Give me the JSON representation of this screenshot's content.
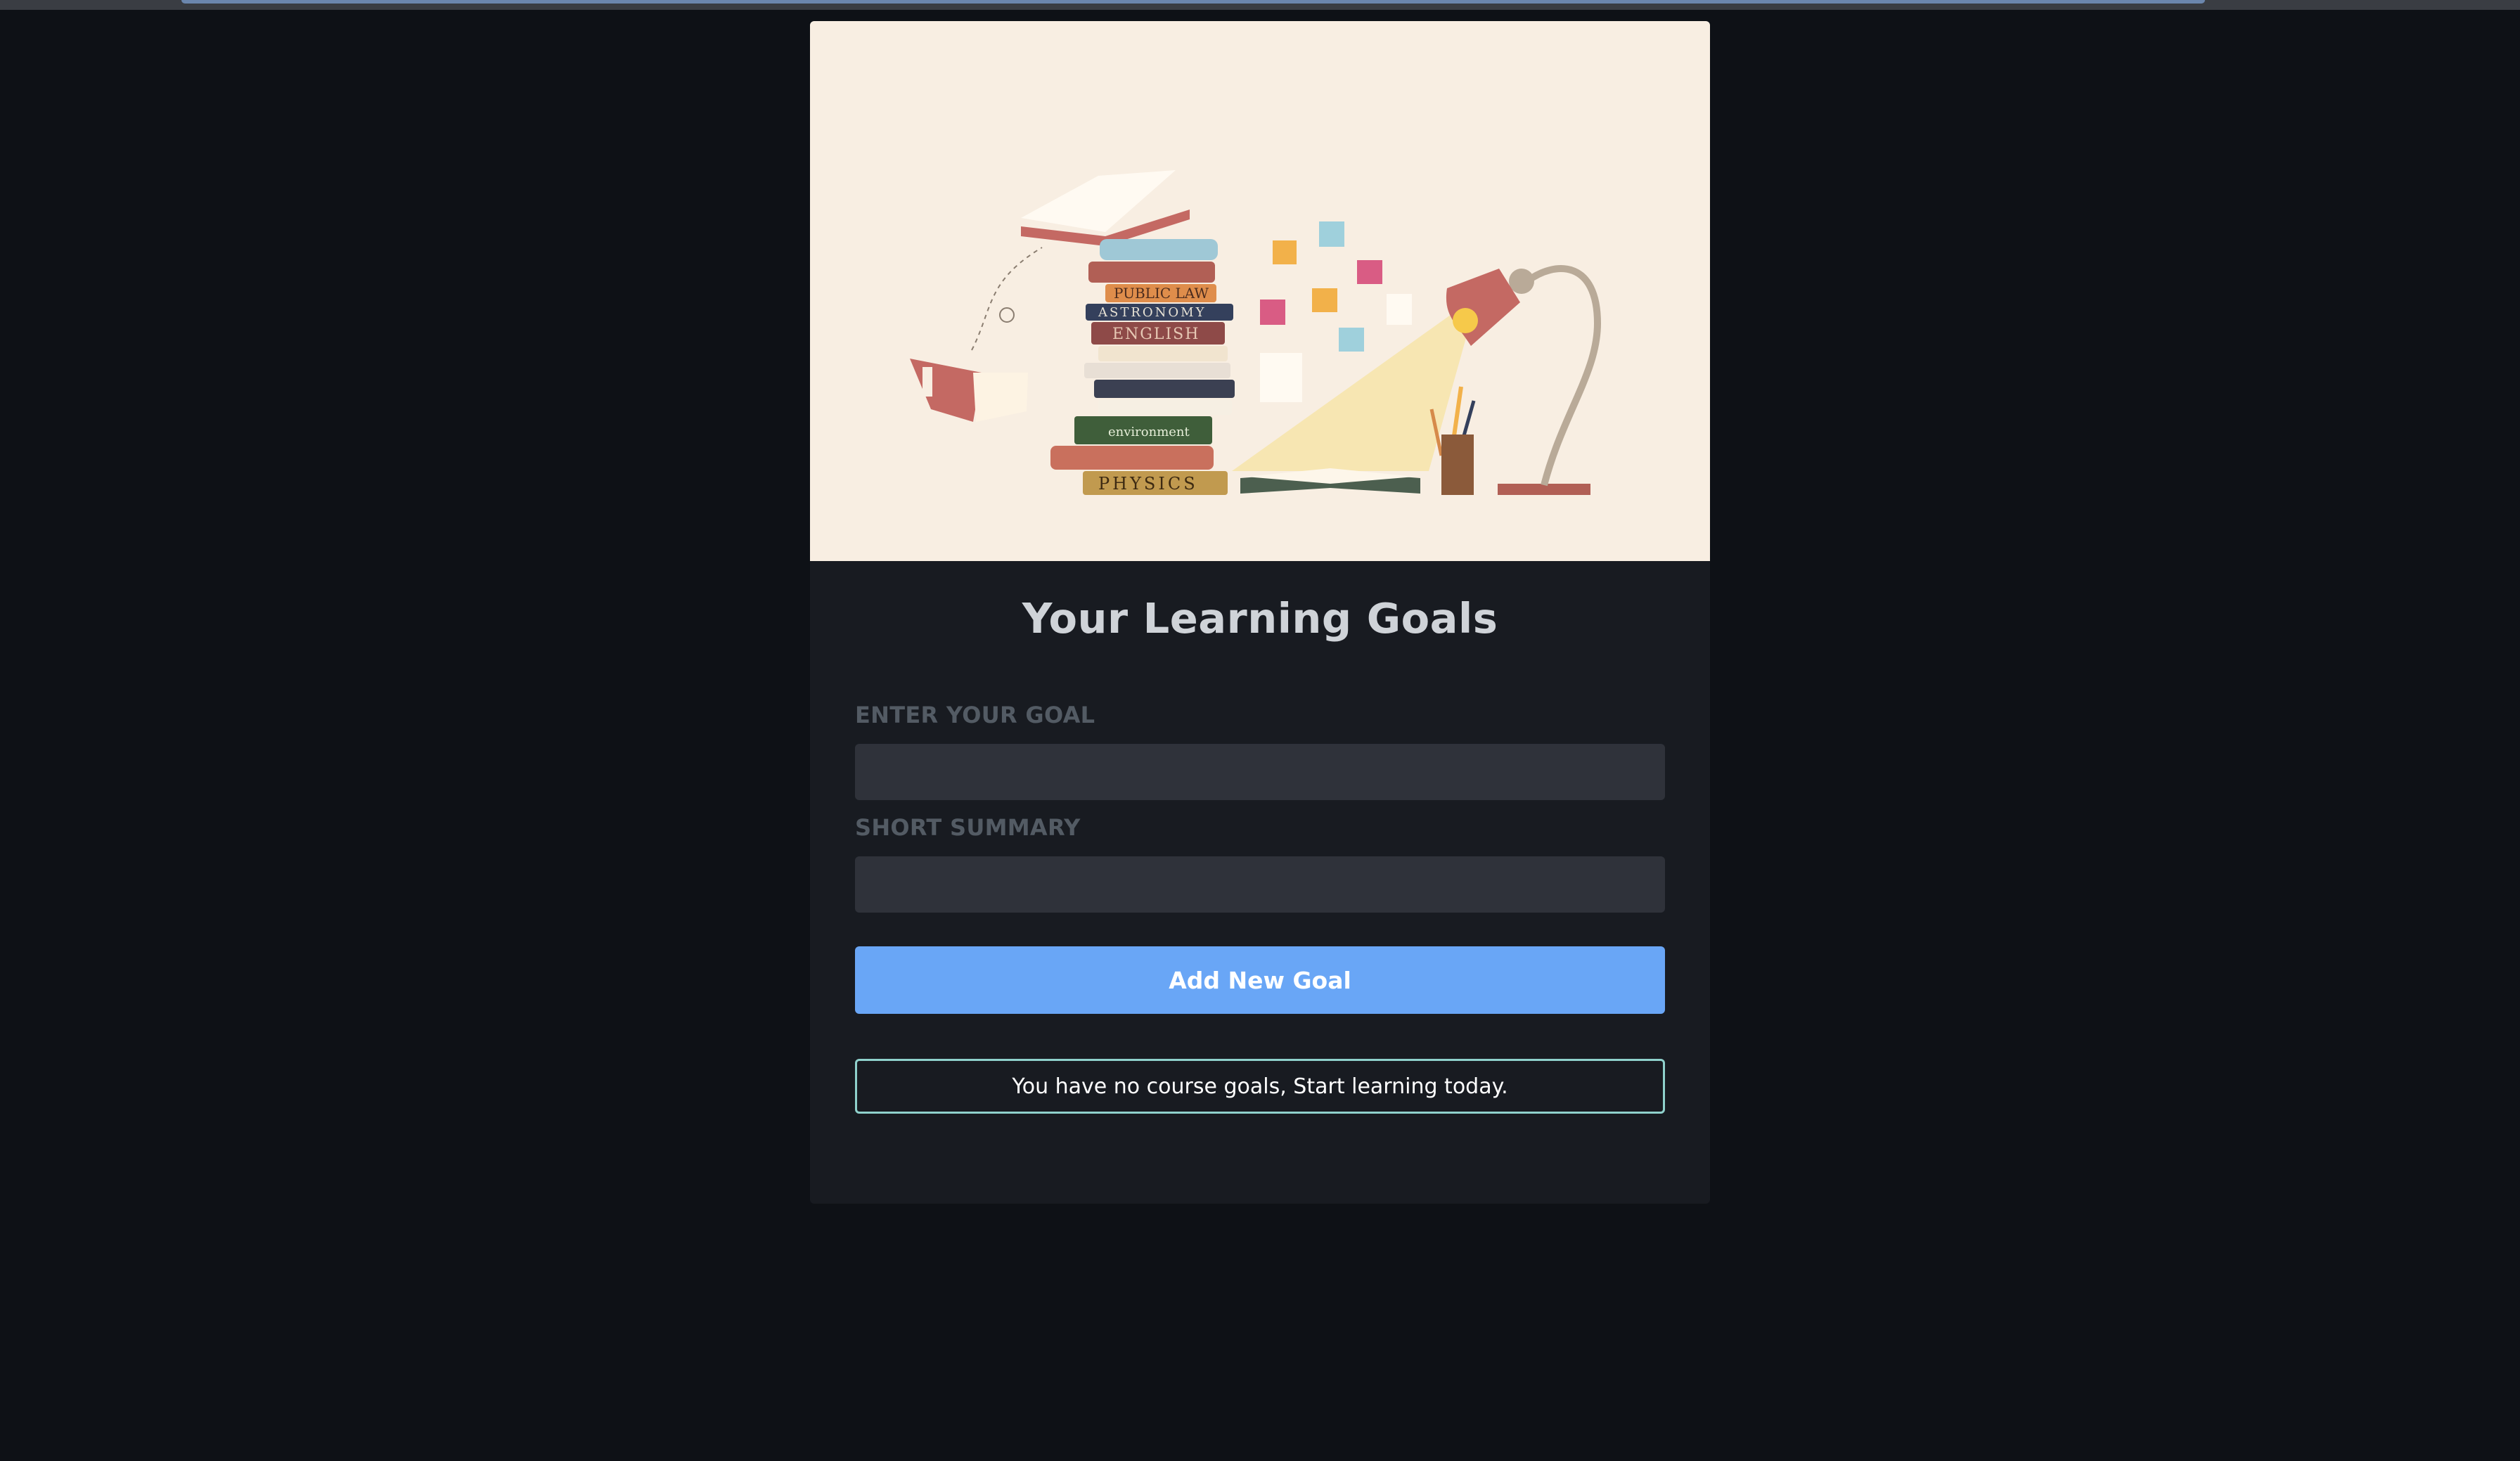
{
  "page": {
    "title": "Your Learning Goals"
  },
  "illustration": {
    "name": "books-and-lamp-illustration",
    "book_spines": [
      "PUBLIC LAW",
      "ASTRONOMY",
      "ENGLISH",
      "environment",
      "PHYSICS"
    ]
  },
  "form": {
    "goal_label": "ENTER YOUR GOAL",
    "goal_value": "",
    "summary_label": "SHORT SUMMARY",
    "summary_value": "",
    "submit_label": "Add New Goal"
  },
  "empty_state": {
    "message": "You have no course goals, Start learning today."
  },
  "colors": {
    "background": "#0e1116",
    "card": "#181b21",
    "accent_button": "#69a6f6",
    "notice_border": "#8fd1cc"
  }
}
